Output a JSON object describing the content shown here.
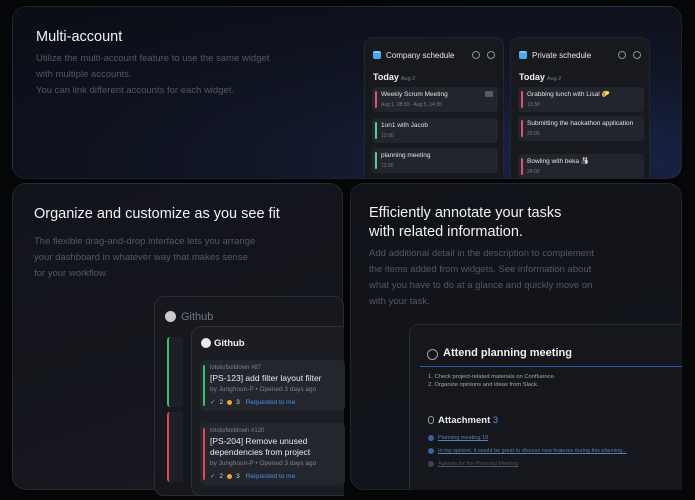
{
  "card1": {
    "title": "Multi-account",
    "desc1": "Utilize the multi-account feature to use the same widget",
    "desc2": "with multiple accounts.",
    "desc3": "You can link different accounts for each widget."
  },
  "company": {
    "title": "Company schedule",
    "today": "Today",
    "date": "Aug 2",
    "events": [
      {
        "title": "Weekly Scrum Meeting",
        "time": "Aug 1, 08:30 - Aug 5, 14:30",
        "color": "#e0507a"
      },
      {
        "title": "1on1 with Jacob",
        "time": "12:00",
        "color": "#4fcf9a"
      },
      {
        "title": "planning meeting",
        "time": "12:00",
        "color": "#4fcf9a"
      }
    ]
  },
  "private": {
    "title": "Private schedule",
    "today": "Today",
    "date": "Aug 2",
    "events": [
      {
        "title": "Grabbing lunch with Lisa! 🌮",
        "time": "13:30",
        "color": "#e05070"
      },
      {
        "title": "Submitting the hackathon application",
        "time": "22:00",
        "color": "#e05070"
      },
      {
        "title": "Bowling with beka 🎳",
        "time": "24:00",
        "color": "#e05070"
      }
    ]
  },
  "card2": {
    "title": "Organize and customize as you see fit",
    "desc1": "The flexible drag-and-drop interface lets you arrange",
    "desc2": "your dashboard in whatever way that makes sense",
    "desc3": "for your workflow."
  },
  "github": {
    "back_title": "Github",
    "title": "Github",
    "prs": [
      {
        "repo": "lotols/boildown #87",
        "title": "[PS-123] add filter layout filter",
        "by": "by Junghoon-P • Opened 3 days ago",
        "checks": "2",
        "comments": "3",
        "status": "Requested to me",
        "color": "#3fbf63"
      },
      {
        "repo": "lotols/boildown #120",
        "title": "[PS-204] Remove unused dependencies from project",
        "by": "by Junghoon-P • Opened 3 days ago",
        "checks": "2",
        "comments": "3",
        "status": "Requested to me",
        "color": "#e04a55"
      }
    ]
  },
  "card3": {
    "title1": "Efficiently annotate your tasks",
    "title2": "with related information.",
    "desc1": "Add additional detail in the description to complement",
    "desc2": "the items added from widgets. See information about",
    "desc3": "what you have to do at a glance and quickly move on",
    "desc4": "with your task."
  },
  "task": {
    "title": "Attend planning meeting",
    "items": [
      "1. Check project-related materials on Confluence.",
      "2. Organize opinions and ideas from Slack."
    ],
    "attachment_label": "Attachment",
    "attachment_count": "3",
    "attachments": [
      "Planning meeting 18",
      "In my opinion, it would be great to discuss new features during this planning...",
      "Agenda for the Planning Meeting"
    ]
  }
}
